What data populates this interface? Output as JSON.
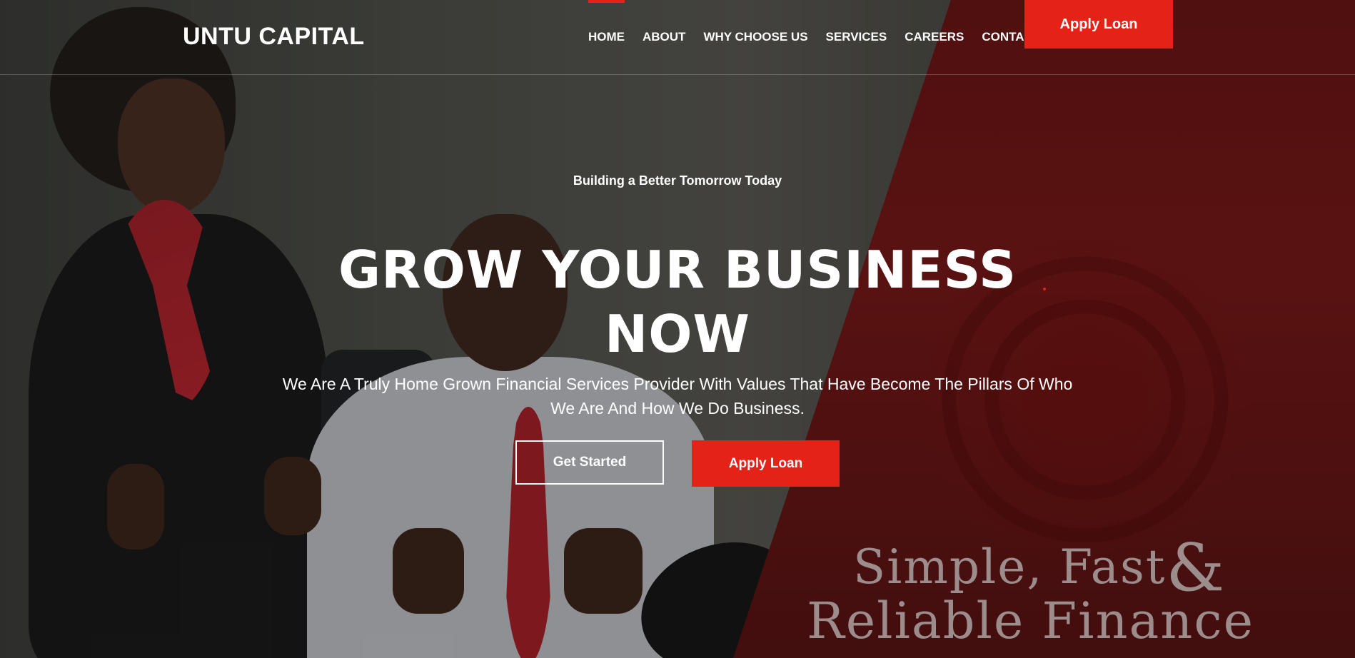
{
  "header": {
    "logo": "UNTU CAPITAL",
    "nav": [
      "HOME",
      "ABOUT",
      "WHY CHOOSE US",
      "SERVICES",
      "CAREERS",
      "CONTACT"
    ],
    "active_nav": "HOME",
    "cta_label": "Apply Loan"
  },
  "hero": {
    "tagline": "Building a Better Tomorrow Today",
    "headline_line1": "GROW YOUR BUSINESS",
    "headline_line2": "NOW",
    "subhead": "We Are A Truly Home Grown Financial Services Provider With Values That Have Become The Pillars Of Who We Are And How We Do Business.",
    "buttons": {
      "get_started": "Get Started",
      "apply_loan": "Apply Loan"
    },
    "slogan": {
      "line1": "Simple, Fast",
      "amp": "&",
      "line2": "Reliable Finance"
    }
  },
  "colors": {
    "accent": "#e52218",
    "panel": "#7b1212"
  }
}
